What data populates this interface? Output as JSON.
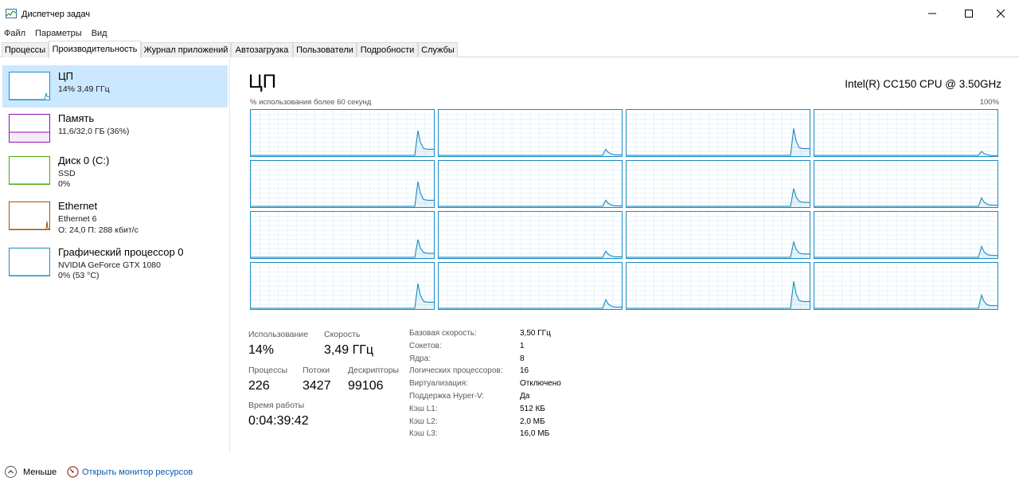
{
  "window": {
    "title": "Диспетчер задач"
  },
  "menu": [
    "Файл",
    "Параметры",
    "Вид"
  ],
  "tabs": [
    "Процессы",
    "Производительность",
    "Журнал приложений",
    "Автозагрузка",
    "Пользователи",
    "Подробности",
    "Службы"
  ],
  "active_tab": 1,
  "sidebar": [
    {
      "name": "ЦП",
      "lines": [
        "14% 3,49 ГГц"
      ],
      "color": "#1a8ec6"
    },
    {
      "name": "Память",
      "lines": [
        "11,6/32,0 ГБ (36%)"
      ],
      "color": "#8b12ae"
    },
    {
      "name": "Диск 0 (C:)",
      "lines": [
        "SSD",
        "0%"
      ],
      "color": "#4da60c"
    },
    {
      "name": "Ethernet",
      "lines": [
        "Ethernet 6",
        "О: 24,0 П: 288 кбит/с"
      ],
      "color": "#a74f01"
    },
    {
      "name": "Графический процессор 0",
      "lines": [
        "NVIDIA GeForce GTX 1080",
        "0% (53 °C)"
      ],
      "color": "#1a8ec6"
    }
  ],
  "cpu": {
    "title": "ЦП",
    "model": "Intel(R) CC150 CPU @ 3.50GHz",
    "graph_label": "% использования более 60 секунд",
    "graph_max": "100%",
    "core_peaks": [
      55,
      15,
      60,
      10,
      55,
      15,
      40,
      20,
      40,
      15,
      35,
      25,
      55,
      20,
      60,
      30
    ]
  },
  "stats": {
    "utilization_label": "Использование",
    "utilization_value": "14%",
    "speed_label": "Скорость",
    "speed_value": "3,49 ГГц",
    "processes_label": "Процессы",
    "processes_value": "226",
    "threads_label": "Потоки",
    "threads_value": "3427",
    "handles_label": "Дескрипторы",
    "handles_value": "99106",
    "uptime_label": "Время работы",
    "uptime_value": "0:04:39:42"
  },
  "info": [
    {
      "key": "Базовая скорость:",
      "value": "3,50 ГГц"
    },
    {
      "key": "Сокетов:",
      "value": "1"
    },
    {
      "key": "Ядра:",
      "value": "8"
    },
    {
      "key": "Логических процессоров:",
      "value": "16"
    },
    {
      "key": "Виртуализация:",
      "value": "Отключено"
    },
    {
      "key": "Поддержка Hyper-V:",
      "value": "Да"
    },
    {
      "key": "Кэш L1:",
      "value": "512 КБ"
    },
    {
      "key": "Кэш L2:",
      "value": "2,0 МБ"
    },
    {
      "key": "Кэш L3:",
      "value": "16,0 МБ"
    }
  ],
  "footer": {
    "less_label": "Меньше",
    "monitor_link": "Открыть монитор ресурсов"
  }
}
